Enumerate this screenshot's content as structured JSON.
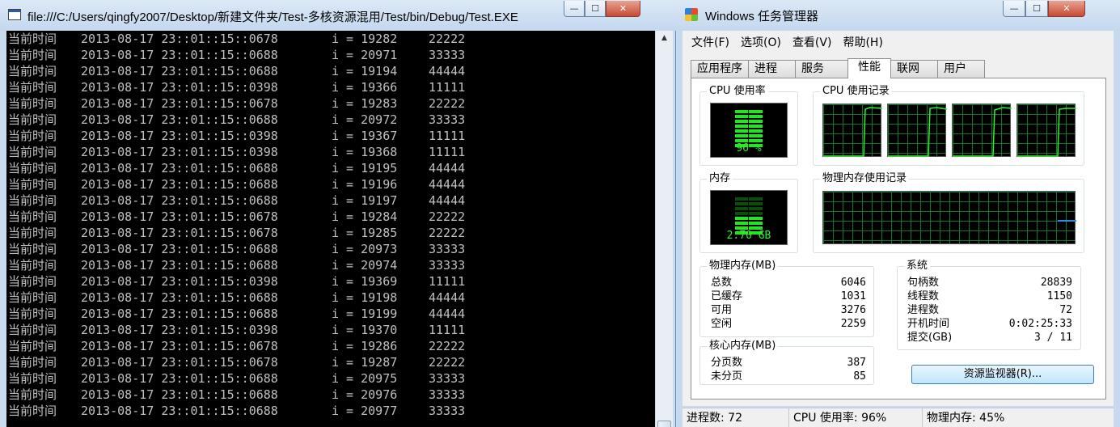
{
  "console": {
    "title": "file:///C:/Users/qingfy2007/Desktop/新建文件夹/Test-多核资源混用/Test/bin/Debug/Test.EXE",
    "label": "当前时间",
    "lines": [
      {
        "ts": "2013-08-17 23::01::15::0678",
        "i": "i = 19282",
        "v": "22222"
      },
      {
        "ts": "2013-08-17 23::01::15::0688",
        "i": "i = 20971",
        "v": "33333"
      },
      {
        "ts": "2013-08-17 23::01::15::0688",
        "i": "i = 19194",
        "v": "44444"
      },
      {
        "ts": "2013-08-17 23::01::15::0398",
        "i": "i = 19366",
        "v": "11111"
      },
      {
        "ts": "2013-08-17 23::01::15::0678",
        "i": "i = 19283",
        "v": "22222"
      },
      {
        "ts": "2013-08-17 23::01::15::0688",
        "i": "i = 20972",
        "v": "33333"
      },
      {
        "ts": "2013-08-17 23::01::15::0398",
        "i": "i = 19367",
        "v": "11111"
      },
      {
        "ts": "2013-08-17 23::01::15::0398",
        "i": "i = 19368",
        "v": "11111"
      },
      {
        "ts": "2013-08-17 23::01::15::0688",
        "i": "i = 19195",
        "v": "44444"
      },
      {
        "ts": "2013-08-17 23::01::15::0688",
        "i": "i = 19196",
        "v": "44444"
      },
      {
        "ts": "2013-08-17 23::01::15::0688",
        "i": "i = 19197",
        "v": "44444"
      },
      {
        "ts": "2013-08-17 23::01::15::0678",
        "i": "i = 19284",
        "v": "22222"
      },
      {
        "ts": "2013-08-17 23::01::15::0678",
        "i": "i = 19285",
        "v": "22222"
      },
      {
        "ts": "2013-08-17 23::01::15::0688",
        "i": "i = 20973",
        "v": "33333"
      },
      {
        "ts": "2013-08-17 23::01::15::0688",
        "i": "i = 20974",
        "v": "33333"
      },
      {
        "ts": "2013-08-17 23::01::15::0398",
        "i": "i = 19369",
        "v": "11111"
      },
      {
        "ts": "2013-08-17 23::01::15::0688",
        "i": "i = 19198",
        "v": "44444"
      },
      {
        "ts": "2013-08-17 23::01::15::0688",
        "i": "i = 19199",
        "v": "44444"
      },
      {
        "ts": "2013-08-17 23::01::15::0398",
        "i": "i = 19370",
        "v": "11111"
      },
      {
        "ts": "2013-08-17 23::01::15::0678",
        "i": "i = 19286",
        "v": "22222"
      },
      {
        "ts": "2013-08-17 23::01::15::0678",
        "i": "i = 19287",
        "v": "22222"
      },
      {
        "ts": "2013-08-17 23::01::15::0688",
        "i": "i = 20975",
        "v": "33333"
      },
      {
        "ts": "2013-08-17 23::01::15::0688",
        "i": "i = 20976",
        "v": "33333"
      },
      {
        "ts": "2013-08-17 23::01::15::0688",
        "i": "i = 20977",
        "v": "33333"
      }
    ]
  },
  "taskmgr": {
    "title": "Windows 任务管理器",
    "menu": [
      "文件(F)",
      "选项(O)",
      "查看(V)",
      "帮助(H)"
    ],
    "tabs": [
      "应用程序",
      "进程",
      "服务",
      "性能",
      "联网",
      "用户"
    ],
    "active_tab": "性能",
    "cpu_usage_title": "CPU 使用率",
    "cpu_usage_value": "96 %",
    "cpu_usage_fraction": 0.96,
    "cpu_history_title": "CPU 使用记录",
    "memory_title": "内存",
    "memory_value": "2.70 GB",
    "memory_fraction": 0.45,
    "memory_history_title": "物理内存使用记录",
    "physical_memory": {
      "title": "物理内存(MB)",
      "rows": [
        {
          "label": "总数",
          "value": "6046"
        },
        {
          "label": "已缓存",
          "value": "1031"
        },
        {
          "label": "可用",
          "value": "3276"
        },
        {
          "label": "空闲",
          "value": "2259"
        }
      ]
    },
    "kernel_memory": {
      "title": "核心内存(MB)",
      "rows": [
        {
          "label": "分页数",
          "value": "387"
        },
        {
          "label": "未分页",
          "value": "85"
        }
      ]
    },
    "system": {
      "title": "系统",
      "rows": [
        {
          "label": "句柄数",
          "value": "28839"
        },
        {
          "label": "线程数",
          "value": "1150"
        },
        {
          "label": "进程数",
          "value": "72"
        },
        {
          "label": "开机时间",
          "value": "0:02:25:33"
        },
        {
          "label": "提交(GB)",
          "value": "3 / 11"
        }
      ]
    },
    "resource_monitor_label": "资源监视器(R)...",
    "status": {
      "processes": "进程数: 72",
      "cpu": "CPU 使用率: 96%",
      "memory": "物理内存: 45%"
    }
  }
}
